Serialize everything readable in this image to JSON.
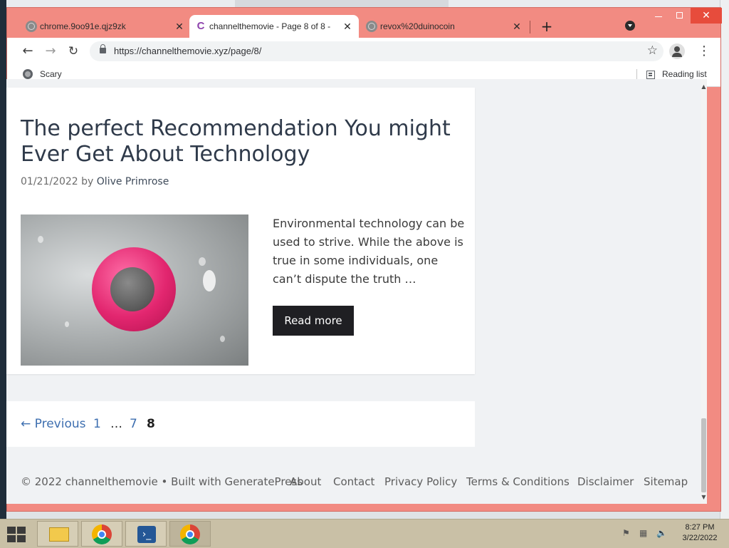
{
  "browser": {
    "tabs": [
      {
        "title": "chrome.9oo91e.qjz9zk",
        "icon": "globe-icon"
      },
      {
        "title": "channelthemovie - Page 8 of 8 -",
        "icon": "site-logo-c",
        "active": true
      },
      {
        "title": "revox%20duinocoin",
        "icon": "globe-icon"
      }
    ],
    "close_glyph": "✕",
    "new_tab_glyph": "+",
    "url": "https://channelthemovie.xyz/page/8/",
    "bookmarks": [
      {
        "label": "Scary",
        "icon": "globe-icon"
      }
    ],
    "reading_list_label": "Reading list"
  },
  "article": {
    "title": "The perfect Recommendation You might Ever Get About Technology",
    "date": "01/21/2022",
    "by": "by",
    "author": "Olive Primrose",
    "excerpt": "Environmental technology can be used to strive. While the above is true in some individuals, one can’t dispute the truth …",
    "read_more_label": "Read more",
    "image_alt": "pink waterproof speaker on glass"
  },
  "pagination": {
    "previous": "← Previous",
    "pages": [
      "1",
      "…",
      "7",
      "8"
    ],
    "current": "8"
  },
  "footer": {
    "copyright": "© 2022 channelthemovie • Built with GeneratePress",
    "links": [
      "About",
      "Contact",
      "Privacy Policy",
      "Terms & Conditions",
      "Disclaimer",
      "Sitemap"
    ]
  },
  "taskbar": {
    "time": "8:27 PM",
    "date": "3/22/2022",
    "apps": [
      "file-explorer-icon",
      "chrome-icon",
      "powershell-icon",
      "chrome-icon"
    ]
  },
  "colors": {
    "tabstrip": "#f28b82",
    "link": "#3e6fb0",
    "button": "#1f1f23",
    "title": "#2f3a4a"
  }
}
